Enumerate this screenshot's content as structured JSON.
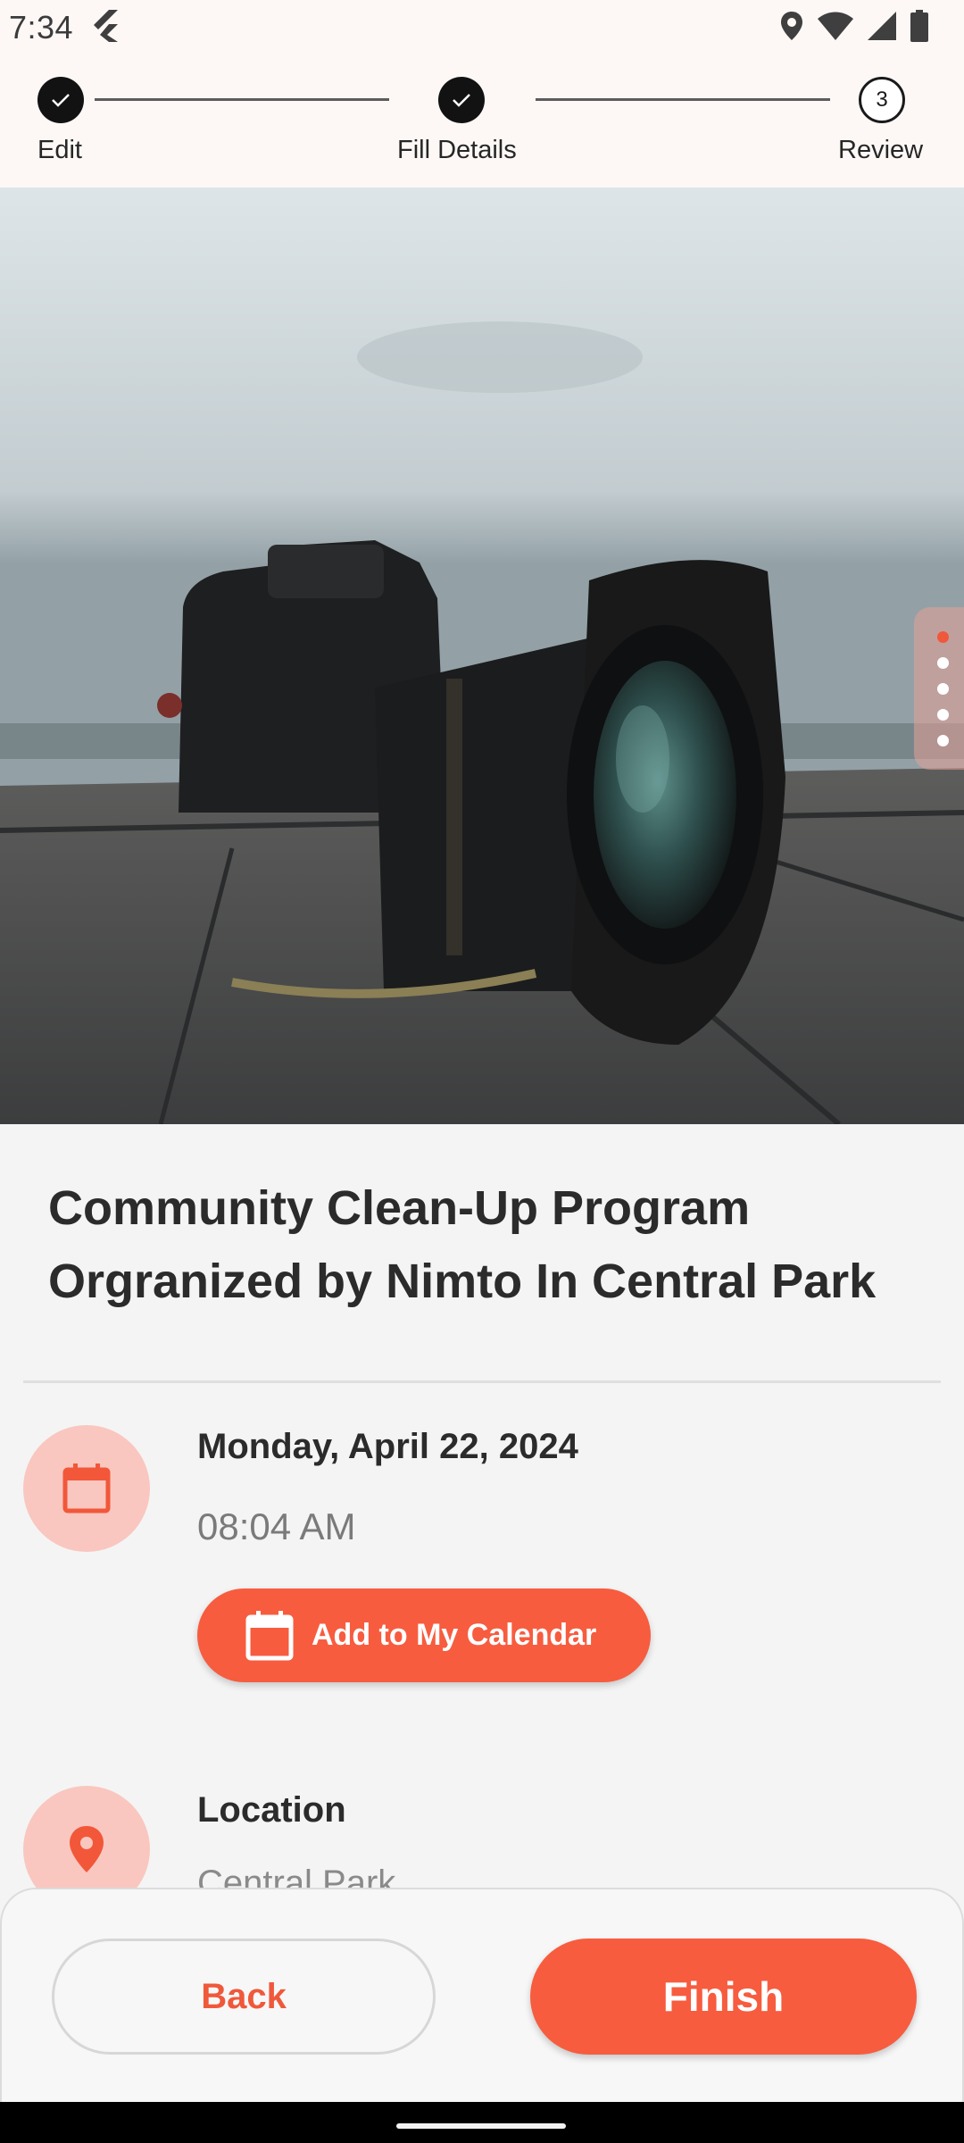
{
  "status_bar": {
    "time": "7:34",
    "icons": [
      "flutter-icon",
      "location-icon",
      "wifi-icon",
      "signal-icon",
      "battery-icon"
    ]
  },
  "stepper": {
    "steps": [
      {
        "label": "Edit",
        "state": "done"
      },
      {
        "label": "Fill Details",
        "state": "done"
      },
      {
        "label": "Review",
        "state": "current",
        "number": "3"
      }
    ]
  },
  "hero": {
    "image": "camera-photo",
    "pager_count": 5,
    "pager_active": 1
  },
  "event": {
    "title_line1": "Community Clean-Up Program",
    "title_line2": "Orgranized by Nimto In Central Park",
    "date": "Monday, April 22, 2024",
    "time": "08:04 AM",
    "calendar_button": "Add to My Calendar",
    "location_label": "Location",
    "location_value": "Central Park"
  },
  "actions": {
    "back": "Back",
    "finish": "Finish"
  },
  "colors": {
    "accent": "#f75c3f",
    "accent_light": "#f9c7bf",
    "header_bg": "#fdf8f6",
    "page_bg": "#f4f4f4"
  }
}
